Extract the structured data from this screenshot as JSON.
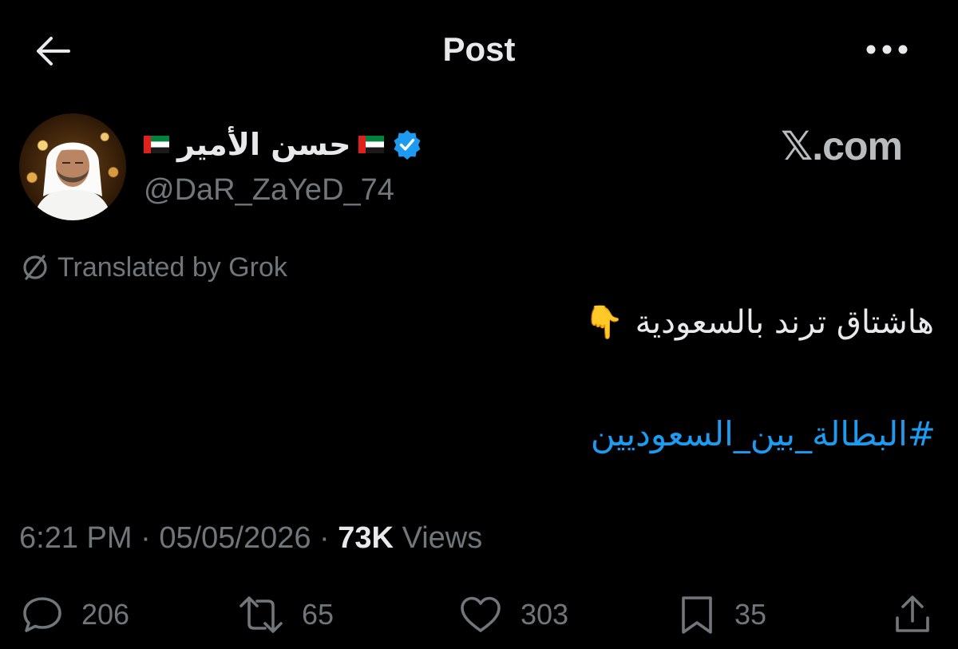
{
  "header": {
    "title": "Post",
    "back_icon": "arrow-left-icon",
    "more_icon": "more-horizontal-icon"
  },
  "author": {
    "display_name": "حسن الأمير",
    "handle": "@DaR_ZaYeD_74",
    "verified": true,
    "flag_icon": "uae-flag-icon"
  },
  "watermark": "𝕏.com",
  "translation": {
    "label": "Translated by Grok"
  },
  "post": {
    "text": "هاشتاق ترند بالسعودية",
    "emoji": "👇",
    "hashtag": "#البطالة_بين_السعوديين"
  },
  "meta": {
    "time": "6:21 PM",
    "separator1": " · ",
    "date": "05/05/2026",
    "separator2": " · ",
    "views_count": "73K",
    "views_label": "Views"
  },
  "actions": {
    "replies": "206",
    "reposts": "65",
    "likes": "303",
    "bookmarks": "35"
  },
  "colors": {
    "background": "#000000",
    "text": "#e7e9ea",
    "muted": "#71767b",
    "accent": "#1d9bf0"
  }
}
